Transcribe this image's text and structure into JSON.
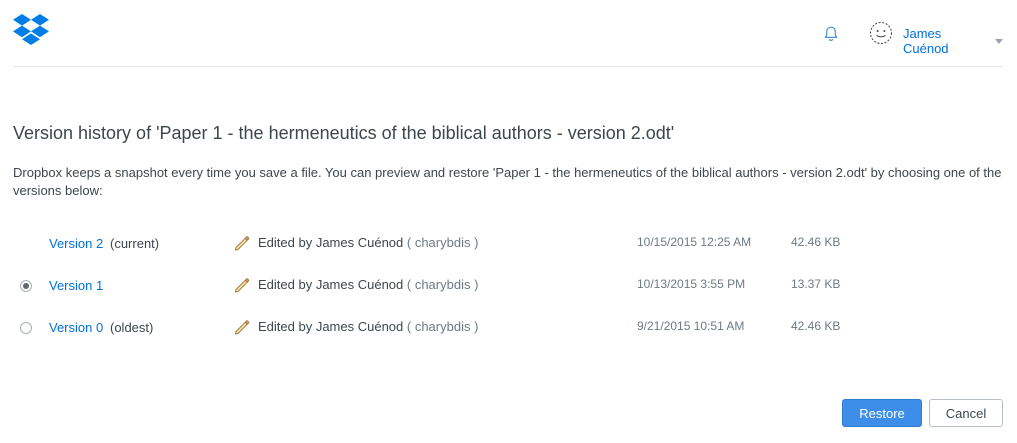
{
  "header": {
    "logo_icon": "dropbox-logo-icon",
    "notification_icon": "bell-icon",
    "user_name": "James Cuénod",
    "accent_color": "#0070e0"
  },
  "main": {
    "title": "Version history of 'Paper 1 - the hermeneutics of the biblical authors - version 2.odt'",
    "description": "Dropbox keeps a snapshot every time you save a file. You can preview and restore 'Paper 1 - the hermeneutics of the biblical authors - version 2.odt' by choosing one of the versions below:"
  },
  "versions": [
    {
      "label": "Version 2",
      "tag": "(current)",
      "editor": "Edited by James Cuénod",
      "device": "( charybdis )",
      "date": "10/15/2015 12:25 AM",
      "size": "42.46 KB",
      "has_radio": false,
      "selected": false
    },
    {
      "label": "Version 1",
      "tag": "",
      "editor": "Edited by James Cuénod",
      "device": "( charybdis )",
      "date": "10/13/2015 3:55 PM",
      "size": "13.37 KB",
      "has_radio": true,
      "selected": true
    },
    {
      "label": "Version 0",
      "tag": "(oldest)",
      "editor": "Edited by James Cuénod",
      "device": "( charybdis )",
      "date": "9/21/2015 10:51 AM",
      "size": "42.46 KB",
      "has_radio": true,
      "selected": false
    }
  ],
  "actions": {
    "restore_label": "Restore",
    "cancel_label": "Cancel",
    "restore_color": "#3d8ee8"
  }
}
